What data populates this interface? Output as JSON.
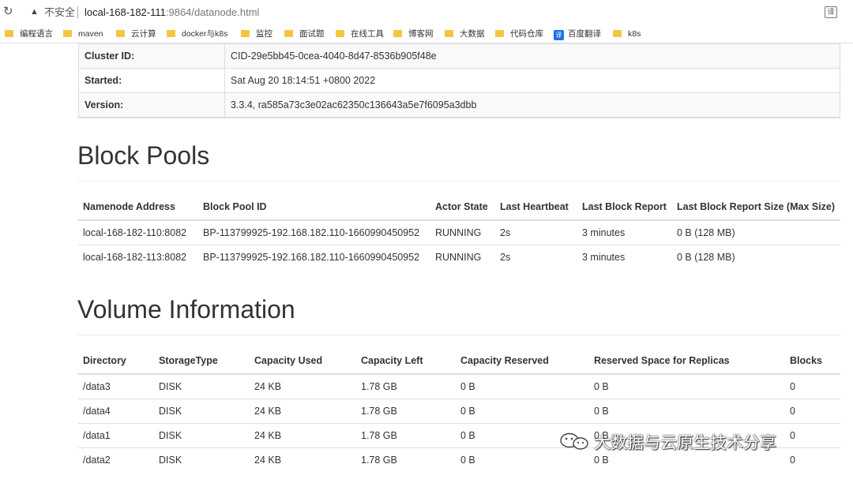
{
  "browser": {
    "insecure_label": "不安全",
    "url_host": "local-168-182-111",
    "url_rest": ":9864/datanode.html",
    "bookmarks": [
      {
        "label": "编程语言",
        "icon": "folder-icon"
      },
      {
        "label": "maven",
        "icon": "folder-icon"
      },
      {
        "label": "云计算",
        "icon": "folder-icon"
      },
      {
        "label": "docker与k8s",
        "icon": "folder-icon"
      },
      {
        "label": "监控",
        "icon": "folder-icon"
      },
      {
        "label": "面试题",
        "icon": "folder-icon"
      },
      {
        "label": "在线工具",
        "icon": "folder-icon"
      },
      {
        "label": "博客网",
        "icon": "folder-icon"
      },
      {
        "label": "大数据",
        "icon": "folder-icon"
      },
      {
        "label": "代码仓库",
        "icon": "folder-icon"
      },
      {
        "label": "百度翻译",
        "icon": "translate-icon"
      },
      {
        "label": "k8s",
        "icon": "folder-icon"
      }
    ]
  },
  "info": [
    {
      "label": "Cluster ID:",
      "value": "CID-29e5bb45-0cea-4040-8d47-8536b905f48e"
    },
    {
      "label": "Started:",
      "value": "Sat Aug 20 18:14:51 +0800 2022"
    },
    {
      "label": "Version:",
      "value": "3.3.4, ra585a73c3e02ac62350c136643a5e7f6095a3dbb"
    }
  ],
  "block_pools": {
    "title": "Block Pools",
    "columns": [
      "Namenode Address",
      "Block Pool ID",
      "Actor State",
      "Last Heartbeat",
      "Last Block Report",
      "Last Block Report Size (Max Size)"
    ],
    "rows": [
      [
        "local-168-182-110:8082",
        "BP-113799925-192.168.182.110-1660990450952",
        "RUNNING",
        "2s",
        "3 minutes",
        "0 B (128 MB)"
      ],
      [
        "local-168-182-113:8082",
        "BP-113799925-192.168.182.110-1660990450952",
        "RUNNING",
        "2s",
        "3 minutes",
        "0 B (128 MB)"
      ]
    ]
  },
  "volumes": {
    "title": "Volume Information",
    "columns": [
      "Directory",
      "StorageType",
      "Capacity Used",
      "Capacity Left",
      "Capacity Reserved",
      "Reserved Space for Replicas",
      "Blocks"
    ],
    "rows": [
      [
        "/data3",
        "DISK",
        "24 KB",
        "1.78 GB",
        "0 B",
        "0 B",
        "0"
      ],
      [
        "/data4",
        "DISK",
        "24 KB",
        "1.78 GB",
        "0 B",
        "0 B",
        "0"
      ],
      [
        "/data1",
        "DISK",
        "24 KB",
        "1.78 GB",
        "0 B",
        "0 B",
        "0"
      ],
      [
        "/data2",
        "DISK",
        "24 KB",
        "1.78 GB",
        "0 B",
        "0 B",
        "0"
      ]
    ]
  },
  "watermark": "大数据与云原生技术分享"
}
